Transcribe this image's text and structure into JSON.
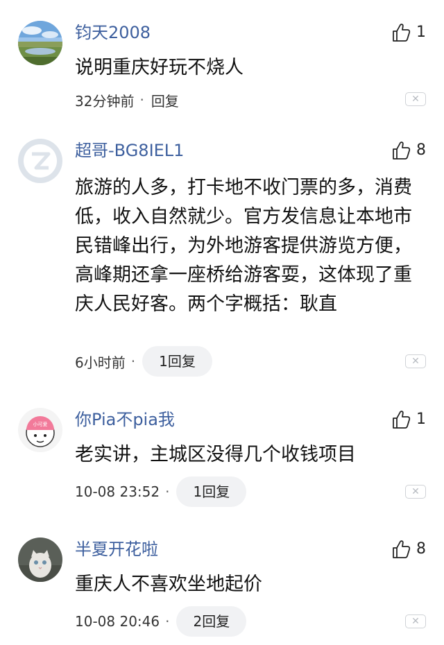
{
  "comments": [
    {
      "username": "钧天2008",
      "likes": "1",
      "content": "说明重庆好玩不烧人",
      "time": "32分钟前",
      "separator": "·",
      "reply": "回复"
    },
    {
      "username": "超哥-BG8IEL1",
      "likes": "8",
      "content": "旅游的人多，打卡地不收门票的多，消费低，收入自然就少。官方发信息让本地市民错峰出行，为外地游客提供游览方便，高峰期还拿一座桥给游客耍，这体现了重庆人民好客。两个字概括：耿直",
      "time": "6小时前",
      "separator": "·",
      "reply": "1回复"
    },
    {
      "username": "你Pia不pia我",
      "likes": "1",
      "content": "老实讲，主城区没得几个收钱项目",
      "time": "10-08 23:52",
      "separator": "·",
      "reply": "1回复",
      "avatar_text": "小可爱"
    },
    {
      "username": "半夏开花啦",
      "likes": "8",
      "content": "重庆人不喜欢坐地起价",
      "time": "10-08 20:46",
      "separator": "·",
      "reply": "2回复"
    }
  ],
  "icons": {
    "like": "thumbs-up-icon",
    "close": "close-icon"
  },
  "colors": {
    "username": "#3d5f9e",
    "pill_bg": "#f1f2f4"
  }
}
